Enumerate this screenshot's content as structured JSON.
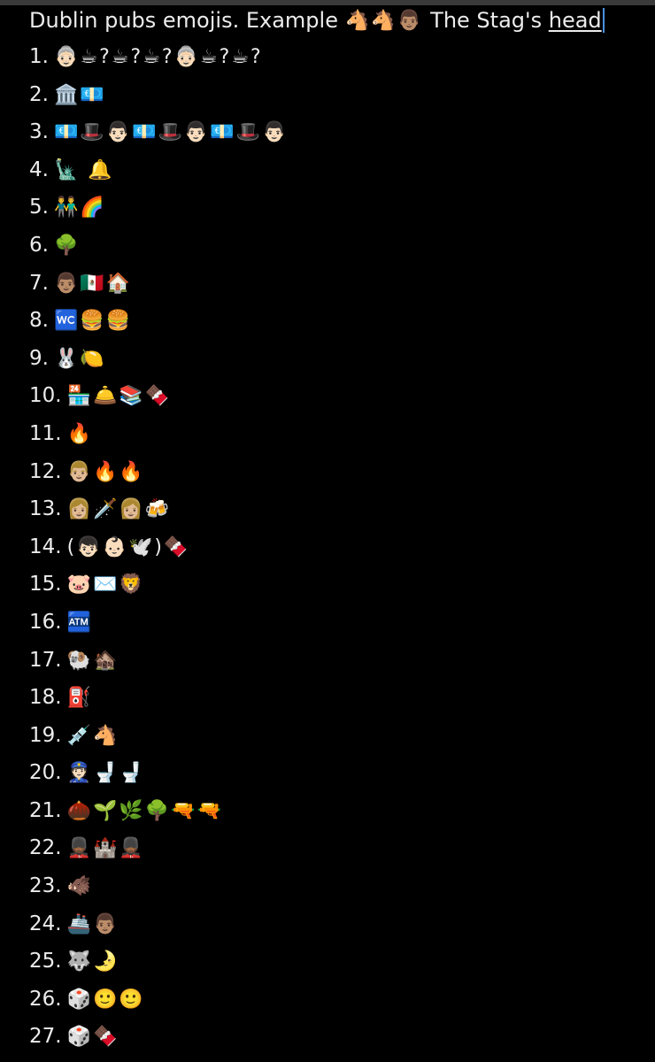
{
  "note": {
    "title_prefix": "Dublin pubs emojis. Example",
    "title_emojis": "🐴🐴👨🏽",
    "title_answer_plain": "The Stag's ",
    "title_answer_underlined": "head"
  },
  "clues": [
    {
      "num": "1.",
      "emojis": "👵🏻☕?☕?☕?👵🏻☕?☕?"
    },
    {
      "num": "2.",
      "emojis": "🏛️💶"
    },
    {
      "num": "3.",
      "emojis": "💶🎩👨🏻💶🎩👨🏻💶🎩👨🏻"
    },
    {
      "num": "4.",
      "emojis": "🗽 🔔"
    },
    {
      "num": "5.",
      "emojis": "👬🌈"
    },
    {
      "num": "6.",
      "emojis": "🌳"
    },
    {
      "num": "7.",
      "emojis": "👨🏽🇲🇽🏠"
    },
    {
      "num": "8.",
      "emojis": "🚾🍔🍔"
    },
    {
      "num": "9.",
      "emojis": "🐰🍋"
    },
    {
      "num": "10.",
      "emojis": "🏪🛎️📚🍫"
    },
    {
      "num": "11.",
      "emojis": "🔥"
    },
    {
      "num": "12.",
      "emojis": "👨🏼🔥🔥"
    },
    {
      "num": "13.",
      "emojis": "👩🏼🗡️👩🏼🍻"
    },
    {
      "num": "14.",
      "emojis": "(👦🏻👶🏻🕊️)🍫"
    },
    {
      "num": "15.",
      "emojis": "🐷✉️🦁"
    },
    {
      "num": "16.",
      "emojis": "🏧"
    },
    {
      "num": "17.",
      "emojis": "🐏🏚️"
    },
    {
      "num": "18.",
      "emojis": "⛽"
    },
    {
      "num": "19.",
      "emojis": "💉🐴"
    },
    {
      "num": "20.",
      "emojis": "👮🏻🚽🚽"
    },
    {
      "num": "21.",
      "emojis": "🌰🌱🌿🌳🔫🔫"
    },
    {
      "num": "22.",
      "emojis": "💂🏾🏰💂🏾"
    },
    {
      "num": "23.",
      "emojis": "🐗"
    },
    {
      "num": "24.",
      "emojis": "🚢👨🏽"
    },
    {
      "num": "25.",
      "emojis": "🐺🌛"
    },
    {
      "num": "26.",
      "emojis": "🎲🙂🙂"
    },
    {
      "num": "27.",
      "emojis": "🎲🍫"
    }
  ]
}
